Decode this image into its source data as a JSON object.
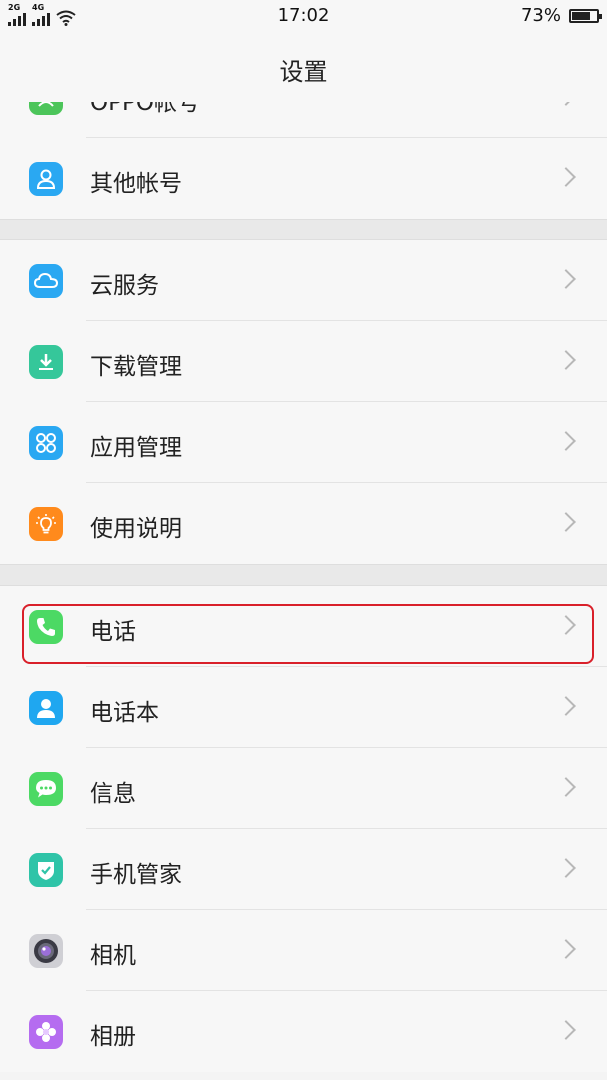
{
  "status_bar": {
    "sim1": "2G",
    "sim2": "4G",
    "time": "17:02",
    "battery": "73%",
    "battery_level": 0.73
  },
  "header": {
    "title": "设置"
  },
  "rows": [
    {
      "label": "OPPO帐号",
      "icon": "oppo-account-icon",
      "color": "#4cc55a"
    },
    {
      "label": "其他帐号",
      "icon": "other-accounts-icon",
      "color": "#2aa8f2"
    },
    {
      "label": "云服务",
      "icon": "cloud-icon",
      "color": "#2aa8f2"
    },
    {
      "label": "下载管理",
      "icon": "download-icon",
      "color": "#35c79a"
    },
    {
      "label": "应用管理",
      "icon": "apps-grid-icon",
      "color": "#2aa8f2"
    },
    {
      "label": "使用说明",
      "icon": "lightbulb-icon",
      "color": "#ff8a1c"
    },
    {
      "label": "电话",
      "icon": "phone-icon",
      "color": "#4cd964"
    },
    {
      "label": "电话本",
      "icon": "contacts-icon",
      "color": "#1fa7f0"
    },
    {
      "label": "信息",
      "icon": "message-icon",
      "color": "#4cd964"
    },
    {
      "label": "手机管家",
      "icon": "shield-check-icon",
      "color": "#2fc4a8"
    },
    {
      "label": "相机",
      "icon": "camera-icon",
      "color": "#cfcfd4"
    },
    {
      "label": "相册",
      "icon": "gallery-flower-icon",
      "color": "#b56cf0"
    }
  ]
}
